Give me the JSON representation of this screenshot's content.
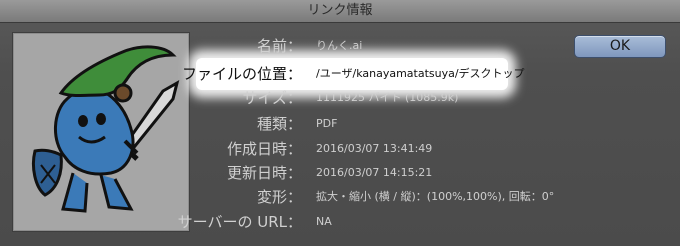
{
  "window": {
    "title": "リンク情報"
  },
  "ok_button": {
    "label": "OK"
  },
  "info": {
    "name": {
      "label": "名前：",
      "value": "りんく.ai"
    },
    "file_location": {
      "label": "ファイルの位置：",
      "value": "/ユーザ/kanayamatatsuya/デスクトップ"
    },
    "size": {
      "label": "サイズ：",
      "value": "1111925 バイト (1085.9k)"
    },
    "kind": {
      "label": "種類：",
      "value": "PDF"
    },
    "created": {
      "label": "作成日時：",
      "value": "2016/03/07 13:41:49"
    },
    "modified": {
      "label": "更新日時：",
      "value": "2016/03/07 14:15:21"
    },
    "transform": {
      "label": "変形：",
      "value": "拡大・縮小 (横 / 縦)：(100%,100%), 回転：0°"
    },
    "server_url": {
      "label": "サーバーの URL：",
      "value": "NA"
    }
  },
  "colors": {
    "window_bg": "#4e4e4e",
    "highlight": "#ffffff",
    "ok_button": "#8ea5c9",
    "character_body": "#3b7ab8",
    "hat": "#3f8d3a"
  }
}
